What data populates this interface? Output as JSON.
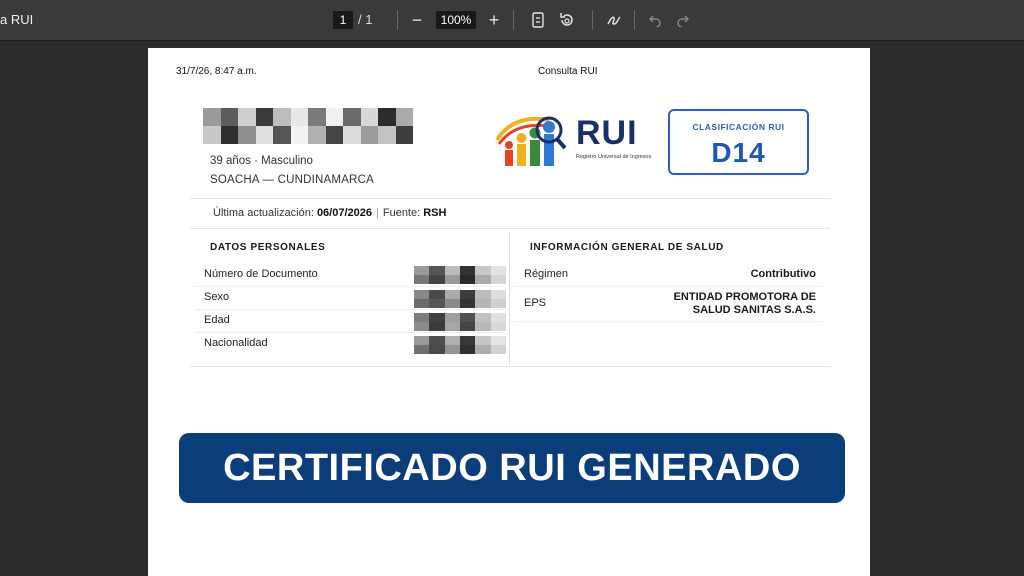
{
  "toolbar": {
    "window_title": "a RUI",
    "page_current": "1",
    "page_separator": "/ 1",
    "zoom": "100%",
    "zoom_out": "−",
    "zoom_in": "+"
  },
  "document": {
    "header_datetime": "31/7/26, 8:47 a.m.",
    "header_title": "Consulta RUI",
    "person_age_sex": "39 años · Masculino",
    "person_location": "SOACHA — CUNDINAMARCA",
    "logo_text": "RUI",
    "logo_subtitle": "Registro Universal de Ingresos",
    "classification_label": "CLASIFICACIÓN RUI",
    "classification_value": "D14",
    "update_label": "Última actualización:",
    "update_date": "06/07/2026",
    "source_label": "Fuente:",
    "source_value": "RSH",
    "personal": {
      "title": "DATOS PERSONALES",
      "rows": [
        {
          "label": "Número de Documento"
        },
        {
          "label": "Sexo"
        },
        {
          "label": "Edad"
        },
        {
          "label": "Nacionalidad"
        }
      ]
    },
    "health": {
      "title": "INFORMACIÓN GENERAL DE SALUD",
      "rows": [
        {
          "label": "Régimen",
          "value": "Contributivo"
        },
        {
          "label": "EPS",
          "value_line1": "ENTIDAD PROMOTORA DE",
          "value_line2": "SALUD SANITAS S.A.S."
        }
      ]
    }
  },
  "banner": {
    "text": "CERTIFICADO RUI GENERADO"
  },
  "colors": {
    "banner_bg": "#0b3d7a",
    "classification_accent": "#2d5fb8",
    "toolbar_bg": "#3a3a3a"
  }
}
